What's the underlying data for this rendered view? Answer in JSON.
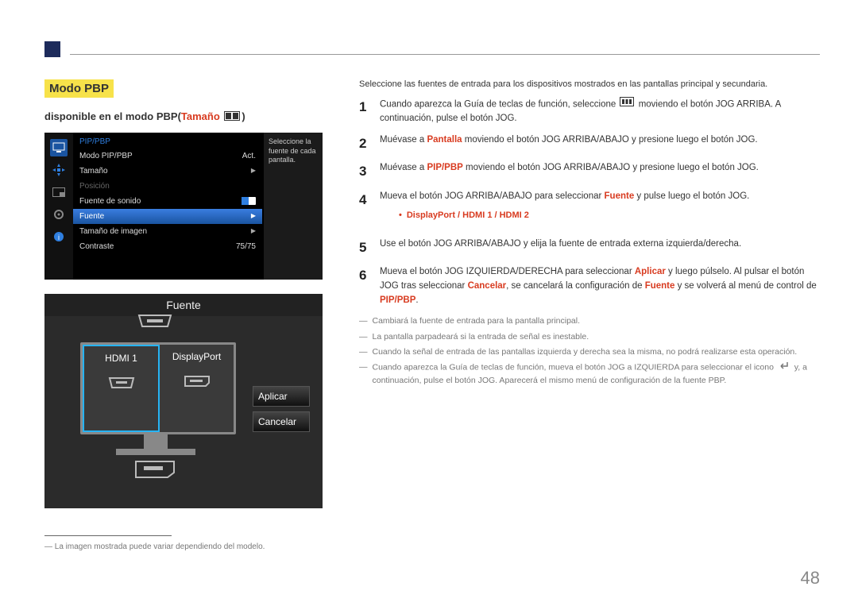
{
  "header": {
    "section": "Modo PBP",
    "subheading_pre": "disponible en el modo PBP(",
    "subheading_red": "Tamaño",
    "subheading_post": ")"
  },
  "osd": {
    "title": "PIP/PBP",
    "rows": {
      "modo_pip": "Modo PIP/PBP",
      "modo_val": "Act.",
      "tamano": "Tamaño",
      "posicion": "Posición",
      "fuente_sonido": "Fuente de sonido",
      "fuente": "Fuente",
      "tamano_img": "Tamaño de imagen",
      "contraste": "Contraste",
      "contraste_val": "75/75"
    },
    "help": "Seleccione la fuente de cada pantalla."
  },
  "fuente": {
    "title": "Fuente",
    "left": "HDMI 1",
    "right": "DisplayPort",
    "apply": "Aplicar",
    "cancel": "Cancelar"
  },
  "footer_note": "La imagen mostrada puede variar dependiendo del modelo.",
  "right": {
    "intro": "Seleccione las fuentes de entrada para los dispositivos mostrados en las pantallas principal y secundaria.",
    "s1_a": "Cuando aparezca la Guía de teclas de función, seleccione ",
    "s1_b": " moviendo el botón JOG ARRIBA. A continuación, pulse el botón JOG.",
    "s2_a": "Muévase a ",
    "s2_red": "Pantalla",
    "s2_b": " moviendo el botón JOG ARRIBA/ABAJO y presione luego el botón JOG.",
    "s3_a": "Muévase a ",
    "s3_red": "PIP/PBP",
    "s3_b": " moviendo el botón JOG ARRIBA/ABAJO y presione luego el botón JOG.",
    "s4_a": "Mueva el botón JOG ARRIBA/ABAJO para seleccionar ",
    "s4_red": "Fuente",
    "s4_b": " y pulse luego el botón JOG.",
    "bullets_label": "DisplayPort / HDMI 1 / HDMI 2",
    "s5": "Use el botón JOG ARRIBA/ABAJO y elija la fuente de entrada externa izquierda/derecha.",
    "s6_a": "Mueva el botón JOG IZQUIERDA/DERECHA para seleccionar ",
    "s6_red1": "Aplicar",
    "s6_b": " y luego púlselo. Al pulsar el botón JOG tras seleccionar ",
    "s6_red2": "Cancelar",
    "s6_c": ", se cancelará la configuración de ",
    "s6_red3": "Fuente",
    "s6_d": " y se volverá al menú de control de ",
    "s6_red4": "PIP/PBP",
    "s6_e": ".",
    "n1": "Cambiará la fuente de entrada para la pantalla principal.",
    "n2": "La pantalla parpadeará si la entrada de señal es inestable.",
    "n3": "Cuando la señal de entrada de las pantallas izquierda y derecha sea la misma, no podrá realizarse esta operación.",
    "n4_a": "Cuando aparezca la Guía de teclas de función, mueva el botón JOG a IZQUIERDA para seleccionar el icono ",
    "n4_b": " y, a continuación, pulse el botón JOG. Aparecerá el mismo menú de configuración de la fuente PBP."
  },
  "page_number": "48",
  "nums": {
    "n1": "1",
    "n2": "2",
    "n3": "3",
    "n4": "4",
    "n5": "5",
    "n6": "6"
  }
}
